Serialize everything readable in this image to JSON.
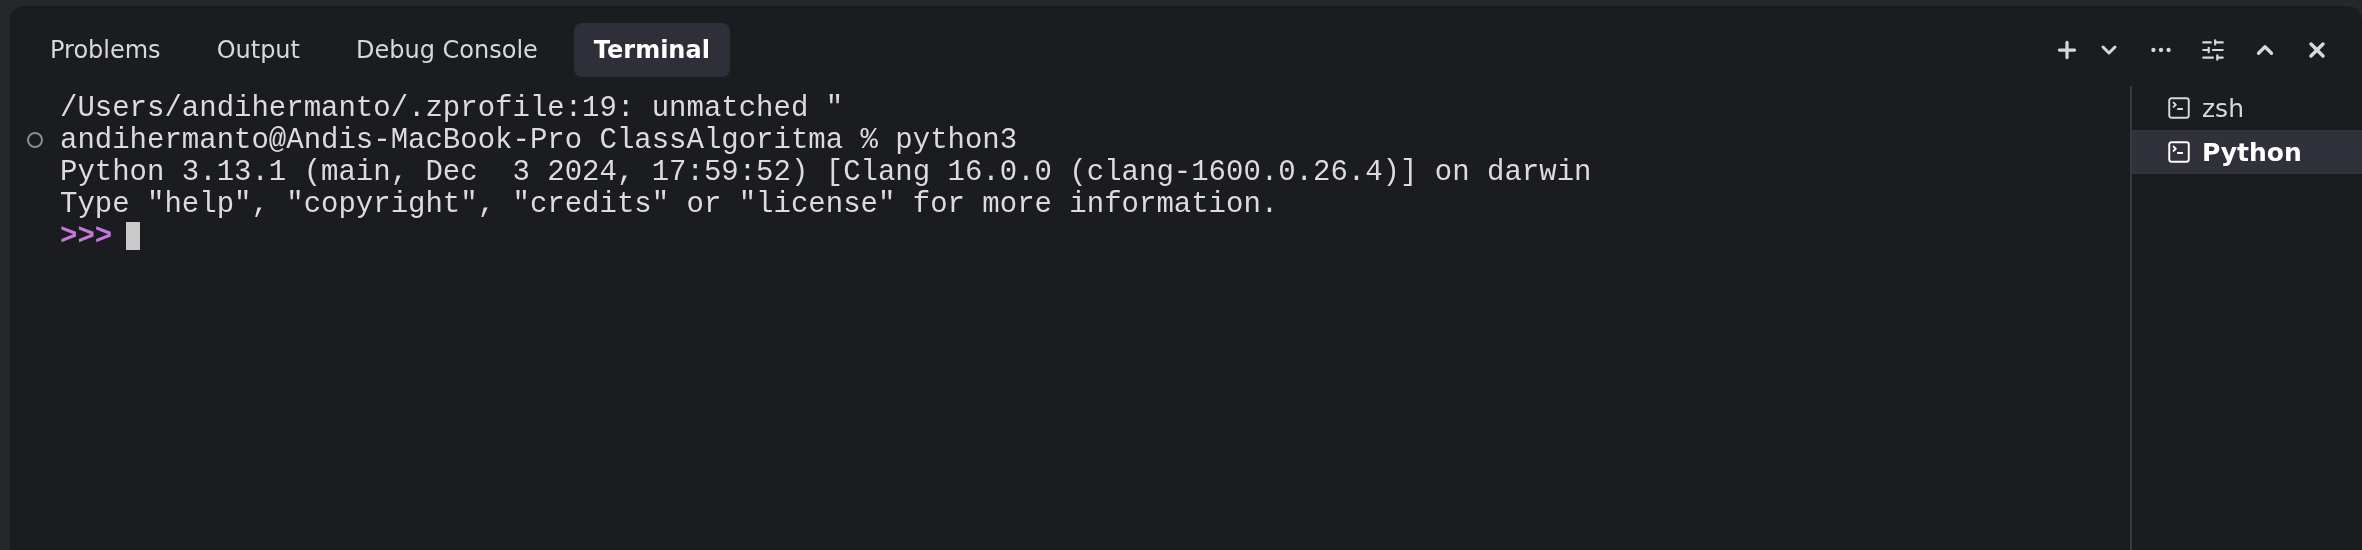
{
  "tabs": [
    {
      "label": "Problems",
      "selected": false
    },
    {
      "label": "Output",
      "selected": false
    },
    {
      "label": "Debug Console",
      "selected": false
    },
    {
      "label": "Terminal",
      "selected": true
    }
  ],
  "terminal_lines": [
    {
      "kind": "output",
      "text": "/Users/andihermanto/.zprofile:19: unmatched \""
    },
    {
      "kind": "command",
      "text": "andihermanto@Andis-MacBook-Pro ClassAlgoritma % python3"
    },
    {
      "kind": "output",
      "text": "Python 3.13.1 (main, Dec  3 2024, 17:59:52) [Clang 16.0.0 (clang-1600.0.26.4)] on darwin"
    },
    {
      "kind": "output",
      "text": "Type \"help\", \"copyright\", \"credits\" or \"license\" for more information."
    },
    {
      "kind": "prompt",
      "text": ">>>"
    }
  ],
  "terminals": [
    {
      "label": "zsh",
      "selected": false
    },
    {
      "label": "Python",
      "selected": true
    }
  ]
}
